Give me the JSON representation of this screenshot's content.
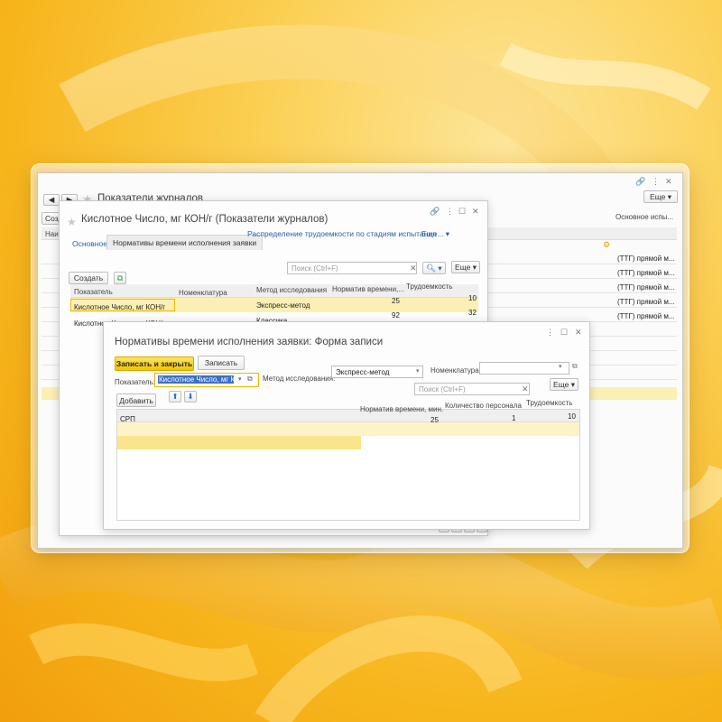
{
  "win1": {
    "title": "Показатели журналов",
    "more_label": "Еще",
    "create_label": "Созд",
    "col_name": "Наим",
    "col_main": "Основное испы...",
    "right_rows": [
      "(ТТГ) прямой м...",
      "(ТТГ) прямой м...",
      "(ТТГ) прямой м...",
      "(ТТГ) прямой м...",
      "(ТТГ) прямой м..."
    ]
  },
  "win2": {
    "title": "Кислотное Число, мг КОН/г (Показатели журналов)",
    "tabs": [
      "Основное",
      "Нормативы времени исполнения заявки",
      "Распределение трудоемкости по стадиям испытания",
      "Еще..."
    ],
    "create_label": "Создать",
    "search_placeholder": "Поиск (Ctrl+F)",
    "more_label": "Еще",
    "columns": [
      "Показатель",
      "Номенклатура",
      "Метод исследования",
      "Норматив времени,...",
      "Трудоемкость"
    ],
    "rows": [
      {
        "indicator": "Кислотное Число, мг КОН/г",
        "nomenclature": "",
        "method": "Экспресс-метод",
        "norm": "25",
        "labor": "10"
      },
      {
        "indicator": "Кислотное Число, мг КОН/г",
        "nomenclature": "",
        "method": "Классика",
        "norm": "92",
        "labor": "32"
      }
    ]
  },
  "win3": {
    "title": "Нормативы времени исполнения заявки: Форма записи",
    "save_close_label": "Записать и закрыть",
    "save_label": "Записать",
    "indicator_label": "Показатель:",
    "indicator_value": "Кислотное Число, мг КОН/г",
    "method_label": "Метод исследования:",
    "method_value": "Экспресс-метод",
    "nomenclature_label": "Номенклатура:",
    "search_placeholder": "Поиск (Ctrl+F)",
    "more_label": "Еще",
    "add_label": "Добавить",
    "columns": [
      "",
      "Норматив времени, мин.",
      "Количество персонала",
      "Трудоемкость"
    ],
    "rows": [
      {
        "name": "СРП",
        "norm": "25",
        "staff": "1",
        "labor": "10"
      }
    ]
  }
}
